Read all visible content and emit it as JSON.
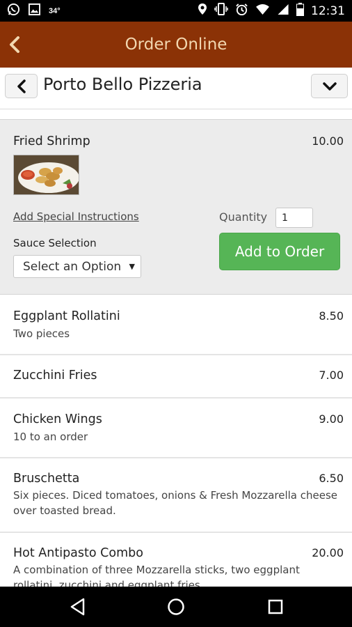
{
  "status_bar": {
    "temperature": "34°",
    "time": "12:31"
  },
  "app_bar": {
    "title": "Order Online"
  },
  "restaurant": {
    "name": "Porto Bello Pizzeria"
  },
  "expanded_item": {
    "name": "Fried Shrimp",
    "price": "10.00",
    "special_instructions_link": "Add Special Instructions",
    "sauce_label": "Sauce Selection",
    "sauce_select_value": "Select an Option",
    "quantity_label": "Quantity",
    "quantity_value": "1",
    "add_button_label": "Add to Order"
  },
  "menu_items": [
    {
      "name": "Eggplant Rollatini",
      "price": "8.50",
      "description": "Two pieces"
    },
    {
      "name": "Zucchini Fries",
      "price": "7.00",
      "description": ""
    },
    {
      "name": "Chicken Wings",
      "price": "9.00",
      "description": "10 to an order"
    },
    {
      "name": "Bruschetta",
      "price": "6.50",
      "description": "Six pieces. Diced tomatoes, onions & Fresh Mozzarella cheese over toasted bread."
    },
    {
      "name": "Hot Antipasto Combo",
      "price": "20.00",
      "description": "A combination of three Mozzarella sticks, two eggplant rollatini, zucchini and eggplant fries"
    }
  ],
  "colors": {
    "app_bar": "#8b3206",
    "title_text": "#f2d7b0",
    "add_button": "#56b556"
  }
}
